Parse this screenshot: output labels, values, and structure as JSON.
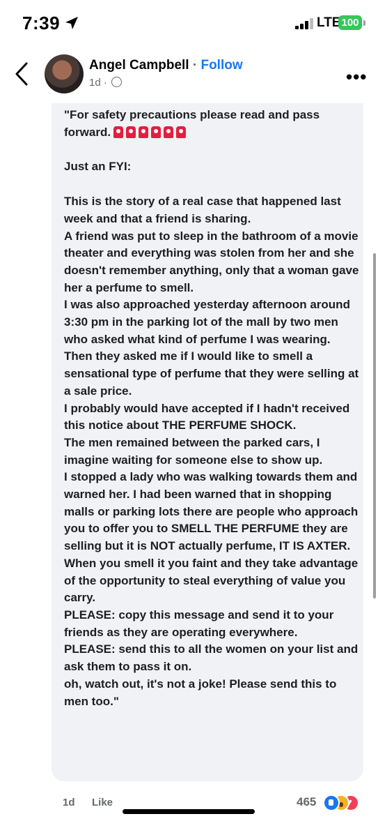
{
  "status_bar": {
    "time": "7:39",
    "network": "LTE",
    "battery": "100",
    "battery_color": "#34c759"
  },
  "post": {
    "author": "Angel Campbell",
    "separator": "·",
    "follow_label": "Follow",
    "time_meta": "1d ·",
    "privacy_icon": "globe-icon",
    "more_icon": "more-options-icon"
  },
  "comment": {
    "intro": "\"For safety precautions please read and pass forward.",
    "siren_icon": "police-siren-emoji",
    "siren_count": 6,
    "fyi": "Just an FYI:",
    "body": "This is the story of a real case that happened last week and that a friend is sharing.\nA friend was put to sleep in the bathroom of a movie theater and everything was stolen from her and she doesn't remember anything, only that a woman gave her a perfume to smell.\nI was also approached yesterday afternoon around 3:30 pm in the parking lot of the mall by two men who asked what kind of perfume I was wearing.\nThen they asked me if I would like to smell a sensational type of perfume that they were selling at a sale price.\nI probably would have accepted if I hadn't received this notice about THE PERFUME SHOCK.\nThe men remained between the parked cars, I imagine waiting for someone else to show up.\n I stopped a lady who was walking towards them and warned her. I had been warned that in shopping malls or parking lots there are people who approach you to offer you to SMELL THE PERFUME they are selling but it is NOT actually perfume, IT IS AXTER.\nWhen you smell it you faint and they take advantage of the opportunity to steal everything of value you carry.\nPLEASE: copy this message and send it to your friends as they are operating everywhere.\nPLEASE: send this to all the women on your list and ask them to pass it on.\noh, watch out, it's not a joke! Please send this to men too.\""
  },
  "footer": {
    "time_ago": "1d",
    "like_label": "Like",
    "reaction_count": "465",
    "reaction_icons": [
      "like-reaction-icon",
      "wow-reaction-icon",
      "love-reaction-icon"
    ],
    "accent_color": "#1877f2"
  }
}
